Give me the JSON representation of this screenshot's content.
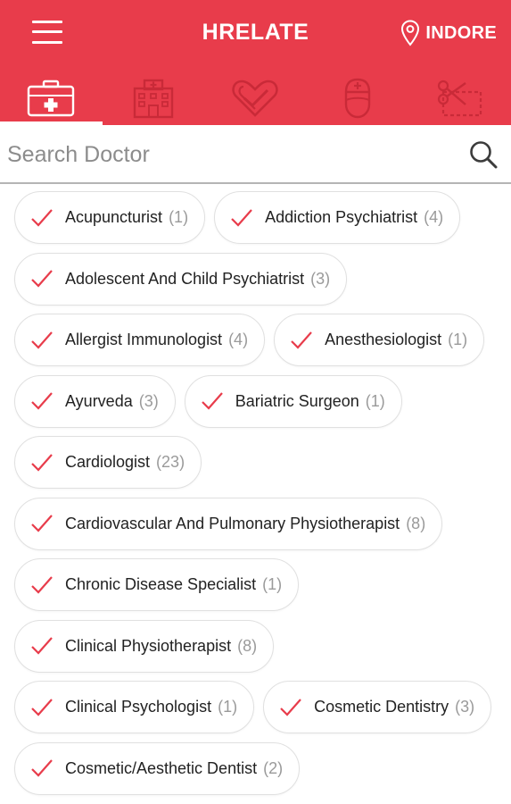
{
  "header": {
    "title": "HRELATE",
    "location": "INDORE"
  },
  "tabs": [
    {
      "icon": "medical-kit-icon"
    },
    {
      "icon": "hospital-icon"
    },
    {
      "icon": "heart-icon"
    },
    {
      "icon": "nurse-icon"
    },
    {
      "icon": "discount-coupon-icon"
    }
  ],
  "search": {
    "placeholder": "Search Doctor",
    "value": ""
  },
  "colors": {
    "accent": "#e83c4b",
    "check": "#e83c4b"
  },
  "specialities": [
    {
      "label": "Acupuncturist",
      "count": "(1)"
    },
    {
      "label": "Addiction Psychiatrist",
      "count": "(4)"
    },
    {
      "label": "Adolescent And Child Psychiatrist",
      "count": "(3)"
    },
    {
      "label": "Allergist Immunologist",
      "count": "(4)"
    },
    {
      "label": "Anesthesiologist",
      "count": "(1)"
    },
    {
      "label": "Ayurveda",
      "count": "(3)"
    },
    {
      "label": "Bariatric Surgeon",
      "count": "(1)"
    },
    {
      "label": "Cardiologist",
      "count": "(23)"
    },
    {
      "label": "Cardiovascular And Pulmonary Physiotherapist",
      "count": "(8)"
    },
    {
      "label": "Chronic Disease Specialist",
      "count": "(1)"
    },
    {
      "label": "Clinical Physiotherapist",
      "count": "(8)"
    },
    {
      "label": "Clinical Psychologist",
      "count": "(1)"
    },
    {
      "label": "Cosmetic Dentistry",
      "count": "(3)"
    },
    {
      "label": "Cosmetic/Aesthetic Dentist",
      "count": "(2)"
    }
  ]
}
